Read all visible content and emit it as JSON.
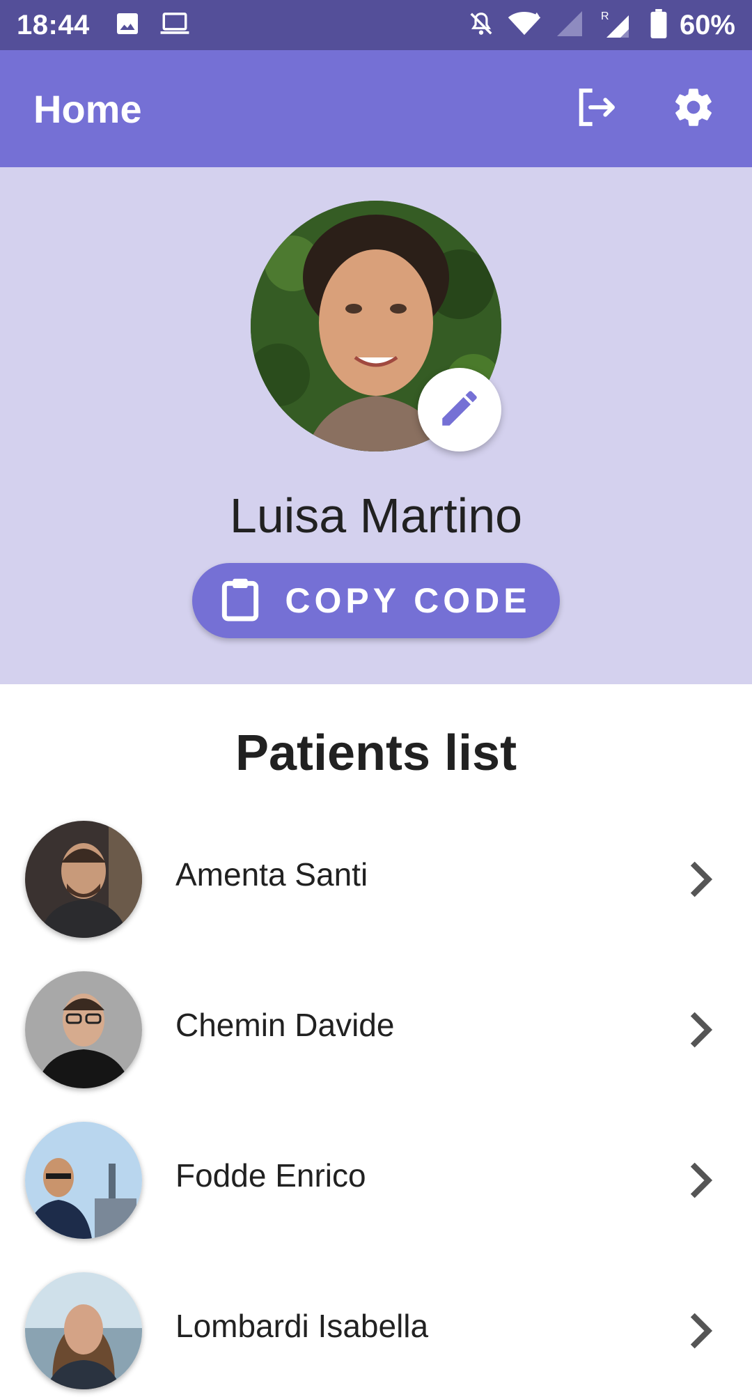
{
  "status_bar": {
    "time": "18:44",
    "battery_text": "60%",
    "icons": [
      "image-icon",
      "laptop-icon",
      "notifications-off-icon",
      "wifi-icon",
      "signal-icon",
      "signal-roaming-icon",
      "battery-icon"
    ]
  },
  "app_bar": {
    "title": "Home",
    "actions": [
      "logout-icon",
      "settings-icon"
    ]
  },
  "profile": {
    "name": "Luisa Martino",
    "copy_code_label": "COPY CODE",
    "edit_icon": "pencil-icon"
  },
  "patients": {
    "title": "Patients list",
    "items": [
      {
        "name": "Amenta Santi"
      },
      {
        "name": "Chemin Davide"
      },
      {
        "name": "Fodde Enrico"
      },
      {
        "name": "Lombardi Isabella"
      }
    ]
  },
  "colors": {
    "status_bar": "#544f99",
    "app_bar": "#7570d5",
    "profile_background": "#d4d1ee",
    "accent": "#7570d5"
  }
}
